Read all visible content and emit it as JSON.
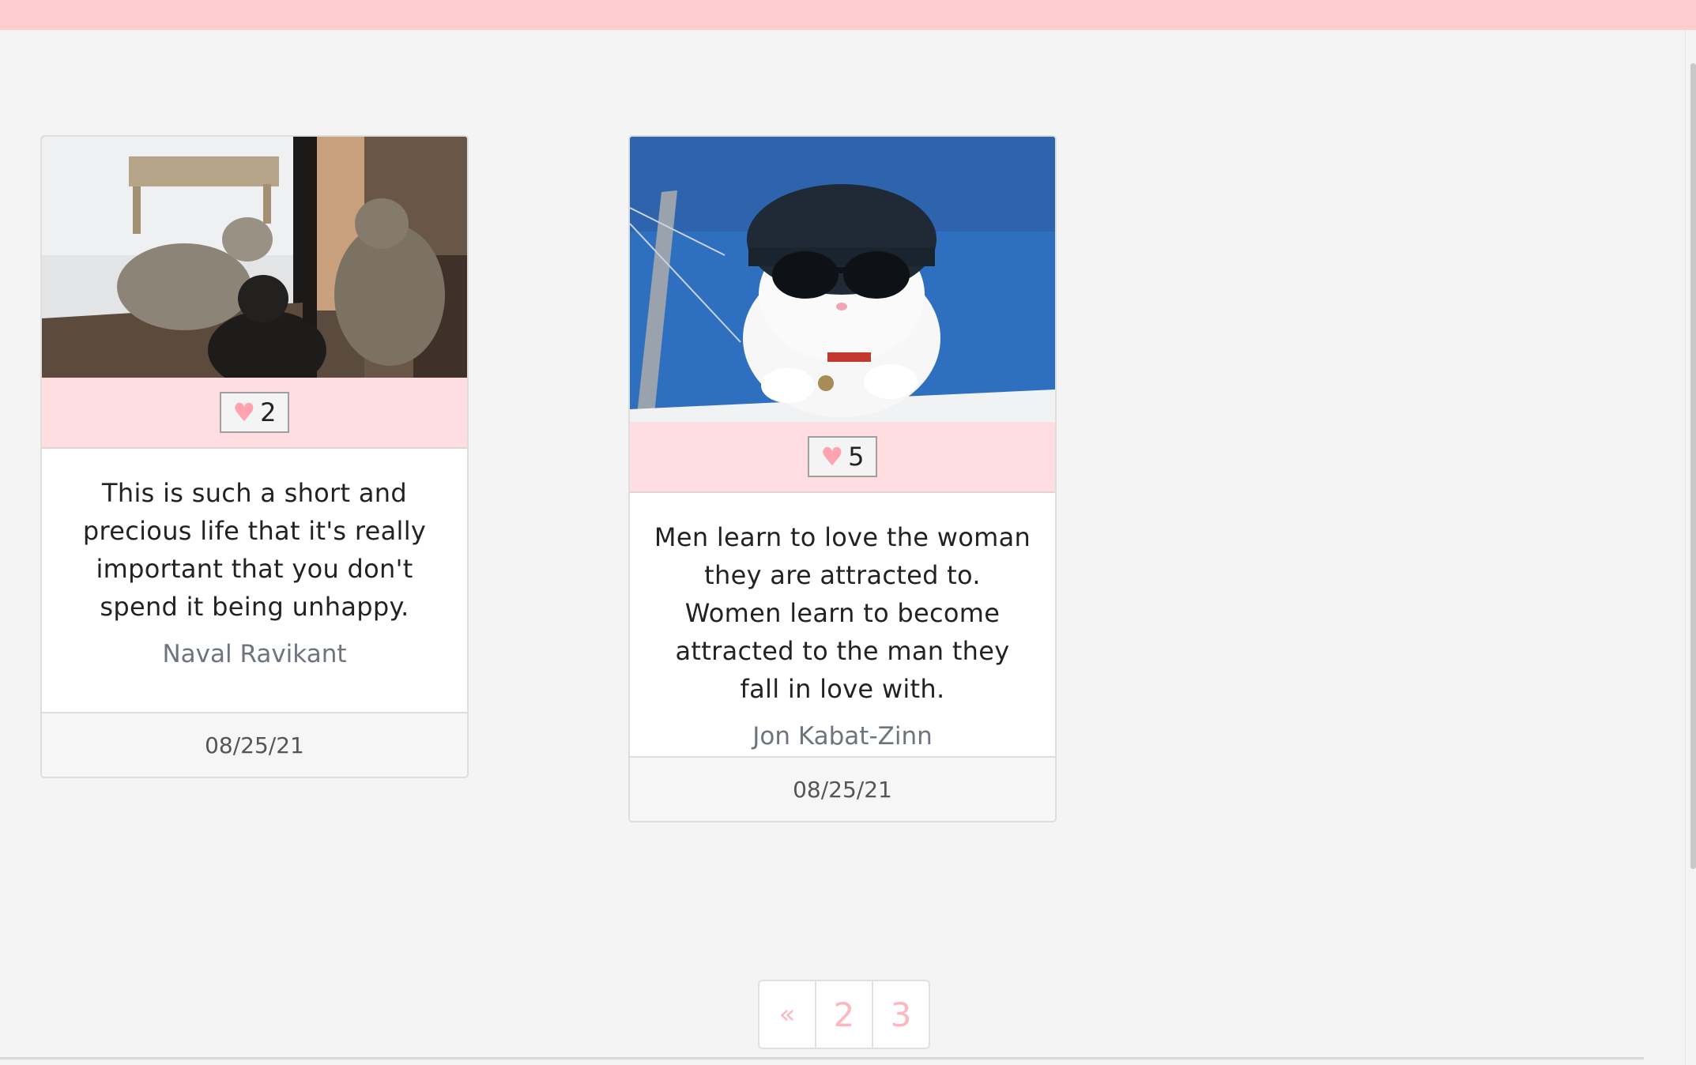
{
  "colors": {
    "topbar": "#ffcdd0",
    "like_bar": "#ffdde0",
    "heart": "#ffa3b0",
    "pagination_text": "#ffb6bf"
  },
  "cards": [
    {
      "image_description": "three cats at a glass door",
      "likes": "2",
      "quote": "This is such a short and precious life that it's really important that you don't spend it being unhappy.",
      "author": "Naval Ravikant",
      "date": "08/25/21"
    },
    {
      "image_description": "white cat wearing a helmet and sunglasses",
      "likes": "5",
      "quote": "Men learn to love the woman they are attracted to. Women learn to become attracted to the man they fall in love with.",
      "author": "Jon Kabat-Zinn",
      "date": "08/25/21"
    }
  ],
  "pagination": {
    "prev_label": "«",
    "pages": [
      "2",
      "3"
    ]
  },
  "icons": {
    "like": "heart-icon"
  }
}
